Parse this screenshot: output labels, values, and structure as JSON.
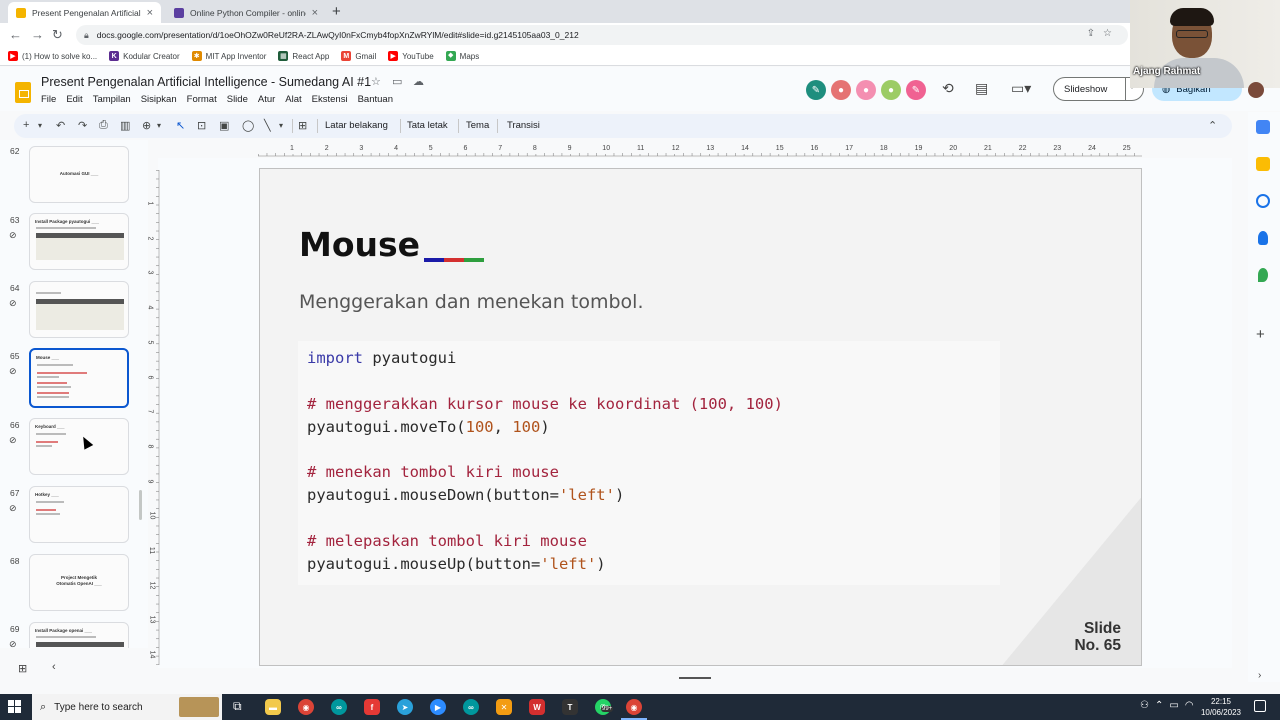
{
  "browser": {
    "tabs": [
      {
        "title": "Present Pengenalan Artificial Inte",
        "favicon_color": "#f4b400",
        "active": true
      },
      {
        "title": "Online Python Compiler - online",
        "favicon_color": "#5b3fa0",
        "active": false
      }
    ],
    "url": "docs.google.com/presentation/d/1oeOhOZw0ReUf2RA-ZLAwQyI0nFxCmyb4fopXnZwRYlM/edit#slide=id.g2145105aa03_0_212",
    "bookmarks": [
      {
        "label": "(1) How to solve ko...",
        "color": "#ff0000"
      },
      {
        "label": "Kodular Creator",
        "color": "#5c2d91"
      },
      {
        "label": "MIT App Inventor",
        "color": "#e08a00"
      },
      {
        "label": "React App",
        "color": "#1f5c3a"
      },
      {
        "label": "Gmail",
        "color": "#ea4335"
      },
      {
        "label": "YouTube",
        "color": "#ff0000"
      },
      {
        "label": "Maps",
        "color": "#34a853"
      }
    ]
  },
  "slides_app": {
    "title": "Present Pengenalan Artificial Intelligence - Sumedang AI #1",
    "menu": [
      "File",
      "Edit",
      "Tampilan",
      "Sisipkan",
      "Format",
      "Slide",
      "Atur",
      "Alat",
      "Ekstensi",
      "Bantuan"
    ],
    "slideshow_label": "Slideshow",
    "share_label": "Bagikan",
    "toolbar_text": [
      "Latar belakang",
      "Tata letak",
      "Tema",
      "Transisi"
    ],
    "collaborator_colors": [
      "#1e8e7e",
      "#e57373",
      "#f48fb1",
      "#9ccc65",
      "#f06292"
    ]
  },
  "filmstrip": [
    {
      "num": "62",
      "title": "Automasi GUI ___",
      "linked": false
    },
    {
      "num": "63",
      "title": "Install Package pyautogui ___",
      "linked": true
    },
    {
      "num": "64",
      "title": "",
      "linked": true
    },
    {
      "num": "65",
      "title": "Mouse ___",
      "linked": true,
      "selected": true
    },
    {
      "num": "66",
      "title": "Keyboard ___",
      "linked": true
    },
    {
      "num": "67",
      "title": "Hotkey ___",
      "linked": true
    },
    {
      "num": "68",
      "title": "Project Mengetik Otomatis OpenAI ___",
      "linked": false
    },
    {
      "num": "69",
      "title": "Install Package openai ___",
      "linked": true
    }
  ],
  "ruler": {
    "h": [
      "1",
      "2",
      "3",
      "4",
      "5",
      "6",
      "7",
      "8",
      "9",
      "10",
      "11",
      "12",
      "13",
      "14",
      "15",
      "16",
      "17",
      "18",
      "19",
      "20",
      "21",
      "22",
      "23",
      "24",
      "25"
    ],
    "v": [
      "1",
      "2",
      "3",
      "4",
      "5",
      "6",
      "7",
      "8",
      "9",
      "10",
      "11",
      "12",
      "13",
      "14"
    ]
  },
  "slide": {
    "title": "Mouse",
    "title_underline_colors": [
      "#1a1aa8",
      "#d32f2f",
      "#2e9e3e"
    ],
    "subtitle": "Menggerakan dan menekan tombol.",
    "code": {
      "l1_kw": "import",
      "l1_rest": " pyautogui",
      "l2_comment": "# menggerakkan kursor mouse ke koordinat (100, 100)",
      "l3_a": "pyautogui.moveTo(",
      "l3_n1": "100",
      "l3_b": ", ",
      "l3_n2": "100",
      "l3_c": ")",
      "l4_comment": "# menekan tombol kiri mouse",
      "l5_a": "pyautogui.mouseDown(button=",
      "l5_s": "'left'",
      "l5_b": ")",
      "l6_comment": "# melepaskan tombol kiri mouse",
      "l7_a": "pyautogui.mouseUp(button=",
      "l7_s": "'left'",
      "l7_b": ")"
    },
    "slide_no_line1": "Slide",
    "slide_no_line2": "No. 65"
  },
  "webcam": {
    "name": "Ajang Rahmat"
  },
  "taskbar": {
    "search_placeholder": "Type here to search",
    "time": "22:15",
    "date": "10/06/2023",
    "whatsapp_badge": "99+"
  }
}
